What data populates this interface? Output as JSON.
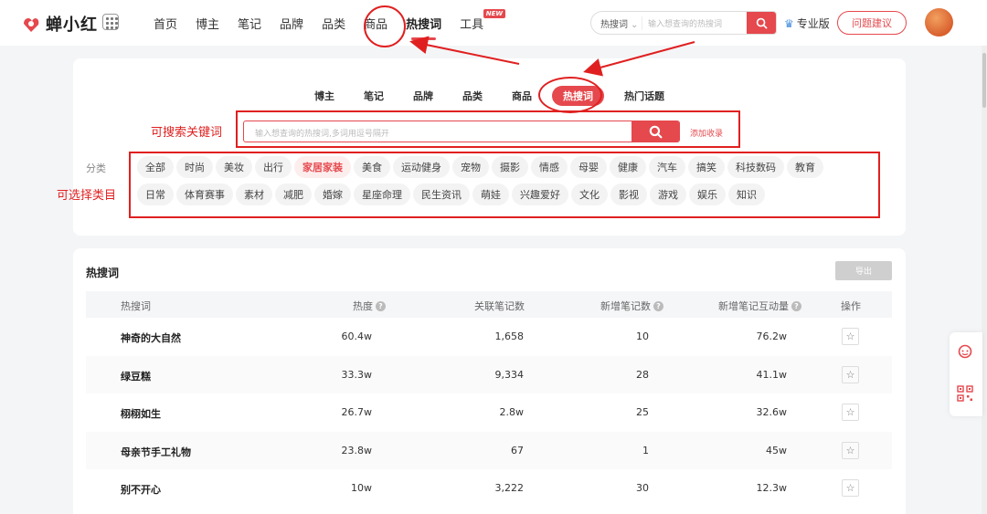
{
  "brand": {
    "name": "蝉小红",
    "accent": "#e5484d",
    "annotation_color": "#e02020"
  },
  "nav": {
    "items": [
      {
        "label": "首页"
      },
      {
        "label": "博主"
      },
      {
        "label": "笔记"
      },
      {
        "label": "品牌"
      },
      {
        "label": "品类"
      },
      {
        "label": "商品"
      },
      {
        "label": "热搜词",
        "active": true
      },
      {
        "label": "工具",
        "badge": "NEW"
      }
    ]
  },
  "top_search": {
    "type_label": "热搜词",
    "placeholder": "输入想查询的热搜词"
  },
  "header_right": {
    "pro_label": "专业版",
    "feedback_label": "问题建议"
  },
  "filter": {
    "tabs": [
      {
        "label": "博主"
      },
      {
        "label": "笔记"
      },
      {
        "label": "品牌"
      },
      {
        "label": "品类"
      },
      {
        "label": "商品"
      },
      {
        "label": "热搜词",
        "active": true
      },
      {
        "label": "热门话题"
      }
    ],
    "search_placeholder": "输入想查询的热搜词,多词用逗号隔开",
    "add_collect_label": "添加收录",
    "category_label": "分类",
    "categories_row1": [
      "全部",
      "时尚",
      "美妆",
      "出行",
      "家居家装",
      "美食",
      "运动健身",
      "宠物",
      "摄影",
      "情感",
      "母婴",
      "健康",
      "汽车",
      "搞笑",
      "科技数码",
      "教育"
    ],
    "categories_row2": [
      "日常",
      "体育赛事",
      "素材",
      "减肥",
      "婚嫁",
      "星座命理",
      "民生资讯",
      "萌娃",
      "兴趣爱好",
      "文化",
      "影视",
      "游戏",
      "娱乐",
      "知识"
    ],
    "active_category": "家居家装"
  },
  "annotations": {
    "search_note": "可搜索关键词",
    "category_note": "可选择类目"
  },
  "table": {
    "title": "热搜词",
    "export_label": "导出",
    "columns": [
      "热搜词",
      "热度",
      "关联笔记数",
      "新增笔记数",
      "新增笔记互动量",
      "操作"
    ],
    "rows": [
      {
        "keyword": "神奇的大自然",
        "heat": "60.4w",
        "notes": "1,658",
        "new_notes": "10",
        "interaction": "76.2w"
      },
      {
        "keyword": "绿豆糕",
        "heat": "33.3w",
        "notes": "9,334",
        "new_notes": "28",
        "interaction": "41.1w"
      },
      {
        "keyword": "栩栩如生",
        "heat": "26.7w",
        "notes": "2.8w",
        "new_notes": "25",
        "interaction": "32.6w"
      },
      {
        "keyword": "母亲节手工礼物",
        "heat": "23.8w",
        "notes": "67",
        "new_notes": "1",
        "interaction": "45w"
      },
      {
        "keyword": "别不开心",
        "heat": "10w",
        "notes": "3,222",
        "new_notes": "30",
        "interaction": "12.3w"
      }
    ]
  },
  "icons": {
    "logo": "chan-logo-icon",
    "apps": "grid-icon",
    "search": "search-icon",
    "crown": "crown-icon",
    "star": "star-icon",
    "service": "customer-service-icon",
    "qr": "qr-code-icon"
  }
}
